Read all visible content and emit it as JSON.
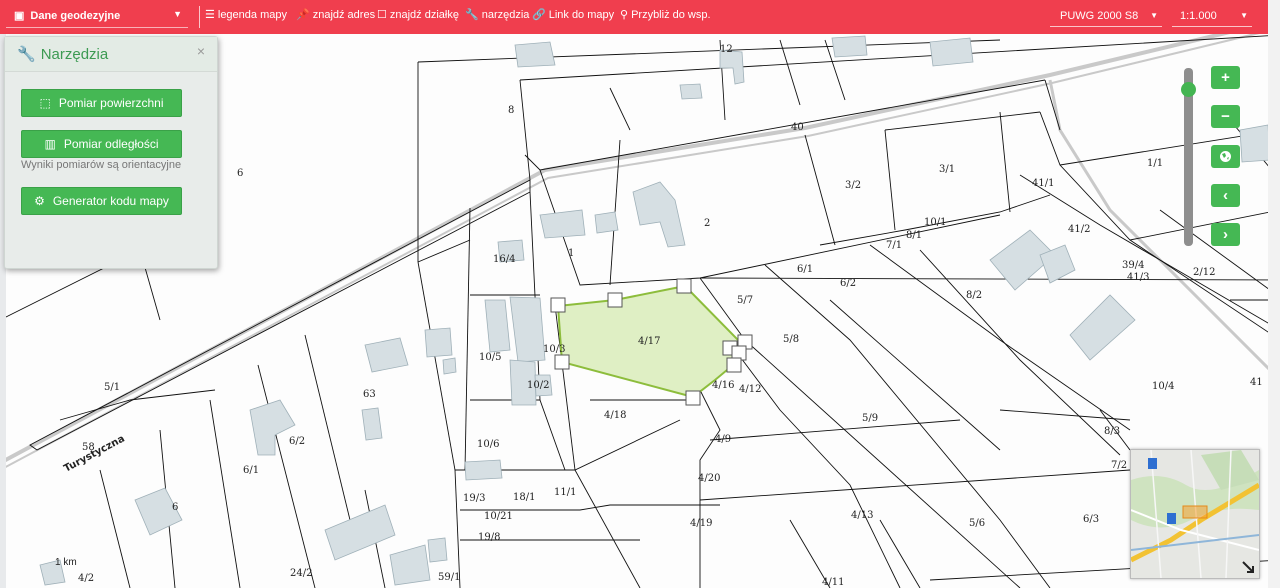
{
  "topbar": {
    "layer_select": "Dane geodezyjne",
    "legend": "legenda mapy",
    "find_address": "znajdź adres",
    "find_parcel": "znajdź działkę",
    "tools": "narzędzia",
    "map_link": "Link do mapy",
    "zoom_to_coords": "Przybliż do wsp.",
    "crs": "PUWG 2000 S8",
    "scale": "1:1.000"
  },
  "tools_panel": {
    "title": "Narzędzia",
    "close": "×",
    "area_button": "Pomiar powierzchni",
    "distance_button": "Pomiar odległości",
    "note": "Wyniki pomiarów są orientacyjne",
    "generator_button": "Generator kodu mapy"
  },
  "zoom": {
    "in": "+",
    "out": "−",
    "globe": "globe-icon",
    "prev": "‹",
    "next": "›"
  },
  "map": {
    "scale_text": "1 km",
    "road_name": "Turystyczna",
    "parcels": [
      "12",
      "8",
      "40",
      "1/1",
      "6",
      "3/2",
      "3/1",
      "41/1",
      "2",
      "41/2",
      "1",
      "10/1",
      "8/1",
      "7/1",
      "6/1",
      "6/2",
      "39/4",
      "41/3",
      "2/12",
      "16/4",
      "5/7",
      "8/2",
      "4/17",
      "10/3",
      "5/8",
      "10/5",
      "10/4",
      "41",
      "5/1",
      "63",
      "4/16",
      "4/12",
      "10/2",
      "4/18",
      "5/9",
      "6/2",
      "6/1",
      "10/6",
      "58",
      "4/9",
      "8/3",
      "7/2",
      "4/20",
      "19/3",
      "18/1",
      "11/1",
      "6",
      "4/13",
      "5/6",
      "6/3",
      "10/21",
      "4/19",
      "19/8",
      "4/2",
      "24/2",
      "59/1",
      "4/11"
    ]
  },
  "colors": {
    "topbar": "#f03e4e",
    "button": "#45b854",
    "selection_fill": "#dfefc4",
    "selection_stroke": "#8dbd3c"
  }
}
